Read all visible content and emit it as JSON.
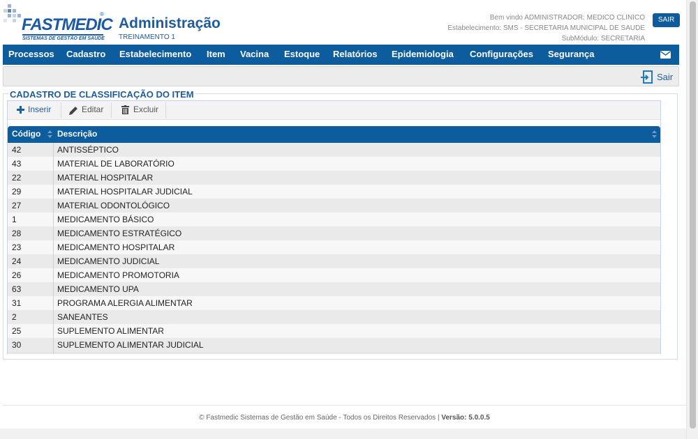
{
  "header": {
    "logo_text": "FASTMEDIC",
    "logo_registered": "®",
    "logo_tagline": "SISTEMAS DE GESTÃO EM SAÚDE",
    "title": "Administração",
    "subtitle": "TREINAMENTO 1",
    "welcome": "Bem vindo ADMINISTRADOR: MEDICO CLINICO",
    "establishment": "Estabelecimento: SMS - SECRETARIA MUNICIPAL DE SAUDE",
    "submodule": "SubMódulo: SECRETARIA",
    "logout_button": "SAIR"
  },
  "nav": {
    "items": [
      "Processos",
      "Cadastro",
      "Estabelecimento",
      "Item",
      "Vacina",
      "Estoque",
      "Relatórios",
      "Epidemiologia",
      "Configurações",
      "Segurança"
    ],
    "mail_icon": "envelope-icon"
  },
  "actionbar": {
    "exit_label": "Sair",
    "exit_icon": "exit-door-icon"
  },
  "panel": {
    "title": "CADASTRO DE CLASSIFICAÇÃO DO ITEM",
    "toolbar": {
      "insert": "Inserir",
      "edit": "Editar",
      "delete": "Excluir"
    },
    "columns": [
      "Código",
      "Descrição"
    ],
    "rows": [
      {
        "code": "42",
        "desc": "ANTISSÉPTICO"
      },
      {
        "code": "43",
        "desc": "MATERIAL DE LABORATÓRIO"
      },
      {
        "code": "22",
        "desc": "MATERIAL HOSPITALAR"
      },
      {
        "code": "29",
        "desc": "MATERIAL HOSPITALAR JUDICIAL"
      },
      {
        "code": "27",
        "desc": "MATERIAL ODONTOLÓGICO"
      },
      {
        "code": "1",
        "desc": "MEDICAMENTO BÁSICO"
      },
      {
        "code": "28",
        "desc": "MEDICAMENTO ESTRATÉGICO"
      },
      {
        "code": "23",
        "desc": "MEDICAMENTO HOSPITALAR"
      },
      {
        "code": "24",
        "desc": "MEDICAMENTO JUDICIAL"
      },
      {
        "code": "26",
        "desc": "MEDICAMENTO PROMOTORIA"
      },
      {
        "code": "63",
        "desc": "MEDICAMENTO UPA"
      },
      {
        "code": "31",
        "desc": "PROGRAMA ALERGIA ALIMENTAR"
      },
      {
        "code": "2",
        "desc": "SANEANTES"
      },
      {
        "code": "25",
        "desc": "SUPLEMENTO ALIMENTAR"
      },
      {
        "code": "30",
        "desc": "SUPLEMENTO ALIMENTAR JUDICIAL"
      }
    ]
  },
  "footer": {
    "text": "© Fastmedic Sistemas de Gestão em Saúde - Todos os Direitos Reservados | ",
    "version_label": "Versão: 5.0.0.5"
  },
  "colors": {
    "brand_blue": "#0d5d9e",
    "title_blue": "#1f5c9c",
    "row_odd": "#eaeaea",
    "row_even": "#f7f7f7"
  }
}
